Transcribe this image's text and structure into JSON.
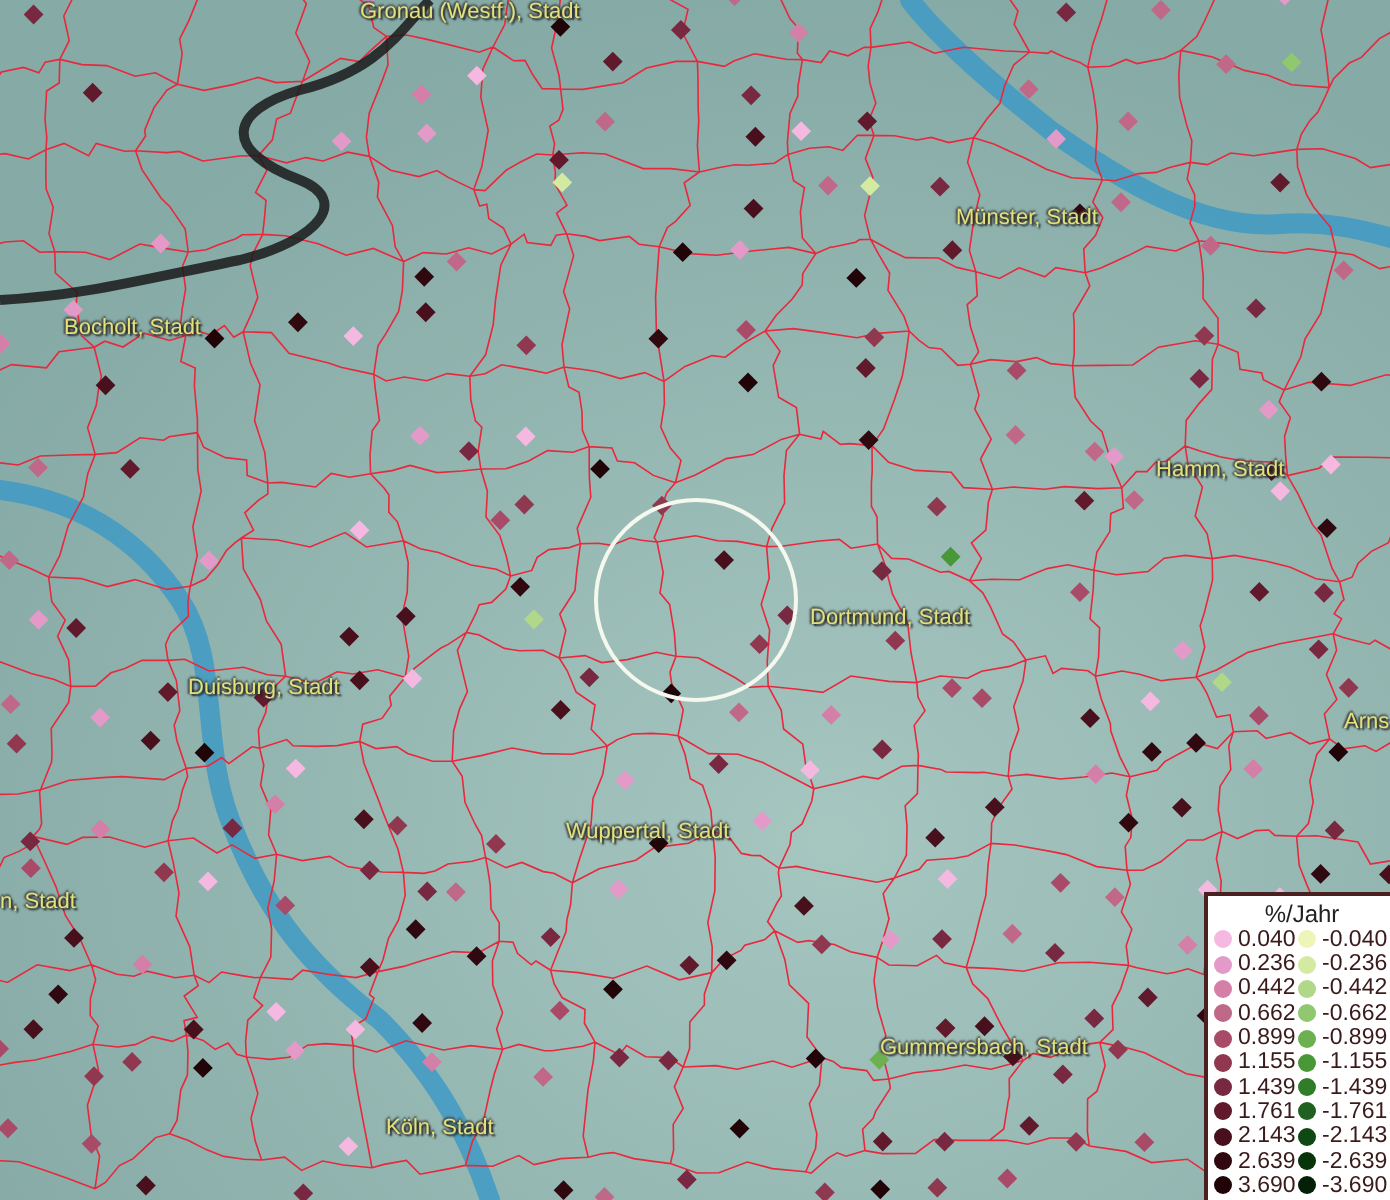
{
  "map": {
    "labels": [
      {
        "text": "Gronau (Westf.), Stadt"
      },
      {
        "text": "Münster, Stadt"
      },
      {
        "text": "Bocholt, Stadt"
      },
      {
        "text": "Hamm, Stadt"
      },
      {
        "text": "Dortmund, Stadt"
      },
      {
        "text": "Duisburg, Stadt"
      },
      {
        "text": "Arns"
      },
      {
        "text": "Wuppertal, Stadt"
      },
      {
        "text": "n, Stadt"
      },
      {
        "text": "Gummersbach, Stadt"
      },
      {
        "text": "Köln, Stadt"
      }
    ]
  },
  "legend": {
    "title": "%/Jahr",
    "items": [
      {
        "value": "0.040",
        "color": "#f5b8e0"
      },
      {
        "value": "-0.040",
        "color": "#eef5b8"
      },
      {
        "value": "0.236",
        "color": "#e49ac8"
      },
      {
        "value": "-0.236",
        "color": "#d4eaa0"
      },
      {
        "value": "0.442",
        "color": "#d47fa8"
      },
      {
        "value": "-0.442",
        "color": "#b0d888"
      },
      {
        "value": "0.662",
        "color": "#c06888"
      },
      {
        "value": "-0.662",
        "color": "#90c870"
      },
      {
        "value": "0.899",
        "color": "#a84a68"
      },
      {
        "value": "-0.899",
        "color": "#6cb050"
      },
      {
        "value": "1.155",
        "color": "#903850"
      },
      {
        "value": "-1.155",
        "color": "#489838"
      },
      {
        "value": "1.439",
        "color": "#782840"
      },
      {
        "value": "-1.439",
        "color": "#307c28"
      },
      {
        "value": "1.761",
        "color": "#601a2c"
      },
      {
        "value": "-1.761",
        "color": "#206020"
      },
      {
        "value": "2.143",
        "color": "#48101c"
      },
      {
        "value": "-2.143",
        "color": "#104814"
      },
      {
        "value": "2.639",
        "color": "#300810"
      },
      {
        "value": "-2.639",
        "color": "#08340c"
      },
      {
        "value": "3.690",
        "color": "#200408"
      },
      {
        "value": "-3.690",
        "color": "#042008"
      }
    ]
  }
}
